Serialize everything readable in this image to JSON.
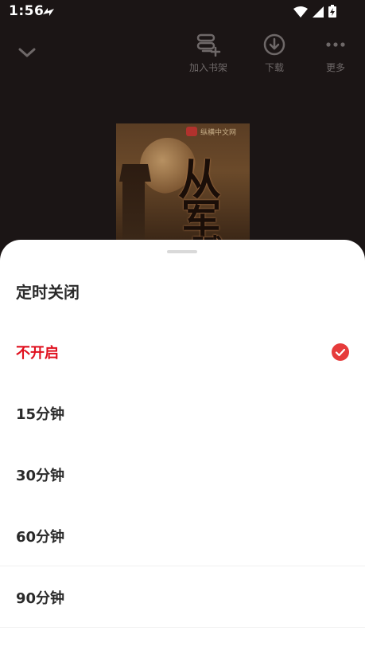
{
  "status_bar": {
    "time": "1:56",
    "icons": [
      "notification-bolt-icon",
      "wifi-icon",
      "signal-icon",
      "battery-charging-icon"
    ]
  },
  "top_bar": {
    "actions": [
      {
        "id": "add-shelf",
        "label": "加入书架",
        "icon": "add-to-shelf-icon"
      },
      {
        "id": "download",
        "label": "下载",
        "icon": "download-icon"
      },
      {
        "id": "more",
        "label": "更多",
        "icon": "more-dots-icon"
      }
    ]
  },
  "cover": {
    "brand": "纵横中文网",
    "title": "从军赋"
  },
  "sheet": {
    "title": "定时关闭",
    "options": [
      {
        "label": "不开启",
        "selected": true
      },
      {
        "label": "15分钟",
        "selected": false
      },
      {
        "label": "30分钟",
        "selected": false
      },
      {
        "label": "60分钟",
        "selected": false
      },
      {
        "label": "90分钟",
        "selected": false
      }
    ]
  },
  "colors": {
    "accent": "#e0101e",
    "check": "#e63b3b",
    "background": "#1b1515",
    "sheet": "#ffffff",
    "text": "#2a2a2a"
  }
}
